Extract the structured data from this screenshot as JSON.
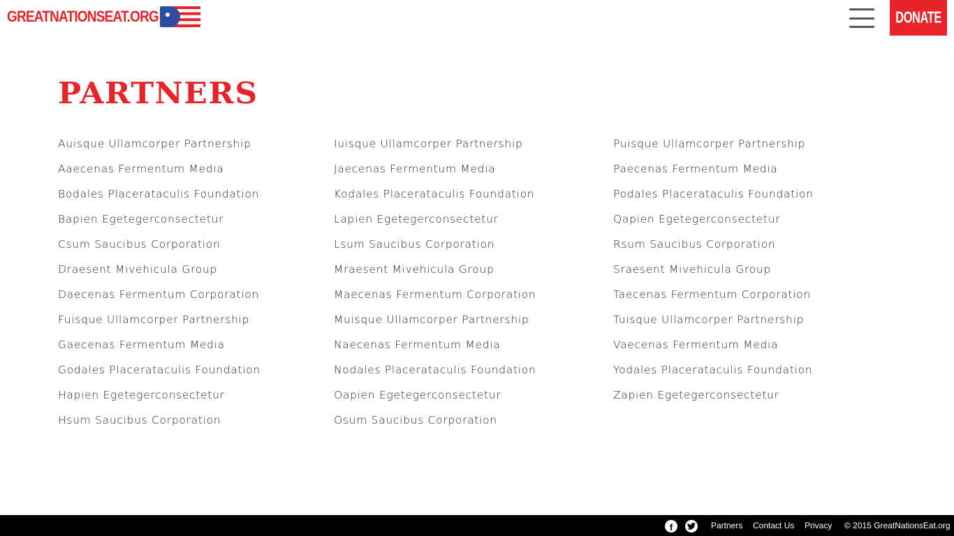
{
  "header": {
    "logo_text": "GREATNATIONSEAT.ORG",
    "donate_label": "DONATE"
  },
  "main": {
    "title": "PARTNERS",
    "columns": [
      [
        "Auisque Ullamcorper Partnership",
        "Aaecenas Fermentum Media",
        "Bodales Placerataculis Foundation",
        "Bapien Egetegerconsectetur",
        "Csum Saucibus Corporation",
        "Draesent Mivehicula Group",
        "Daecenas Fermentum Corporation",
        "Fuisque Ullamcorper Partnership",
        "Gaecenas Fermentum Media",
        "Godales Placerataculis Foundation",
        "Hapien Egetegerconsectetur",
        "Hsum Saucibus Corporation"
      ],
      [
        "Iuisque Ullamcorper Partnership",
        "Jaecenas Fermentum Media",
        "Kodales Placerataculis Foundation",
        "Lapien Egetegerconsectetur",
        "Lsum Saucibus Corporation",
        "Mraesent Mivehicula Group",
        "Maecenas Fermentum Corporation",
        "Muisque Ullamcorper Partnership",
        "Naecenas Fermentum Media",
        "Nodales Placerataculis Foundation",
        "Oapien Egetegerconsectetur",
        "Osum Saucibus Corporation"
      ],
      [
        "Puisque Ullamcorper Partnership",
        "Paecenas Fermentum Media",
        "Podales Placerataculis Foundation",
        "Qapien Egetegerconsectetur",
        "Rsum Saucibus Corporation",
        "Sraesent Mivehicula Group",
        "Taecenas Fermentum Corporation",
        "Tuisque Ullamcorper Partnership",
        "Vaecenas Fermentum Media",
        "Yodales Placerataculis Foundation",
        "Zapien Egetegerconsectetur"
      ]
    ]
  },
  "footer": {
    "links": {
      "partners": "Partners",
      "contact": "Contact Us",
      "privacy": "Privacy"
    },
    "copyright": "© 2015 GreatNationsEat.org",
    "social_icons": [
      "facebook-icon",
      "twitter-icon"
    ]
  },
  "colors": {
    "brand_red": "#e8232a",
    "flag_blue": "#2b4ea2",
    "text": "#2a2a2a",
    "footer_bg": "#000000"
  }
}
